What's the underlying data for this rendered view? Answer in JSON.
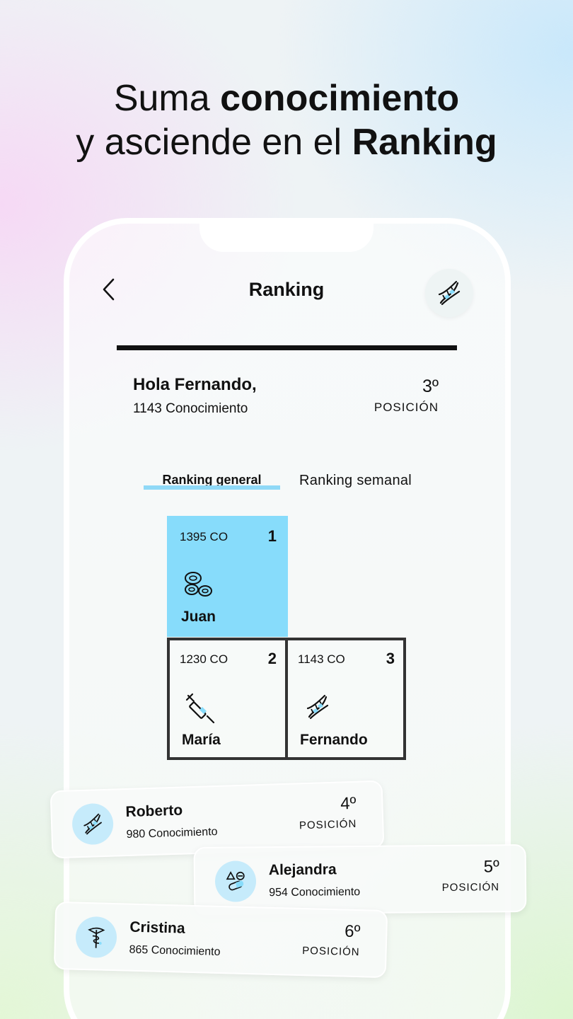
{
  "headline": {
    "line1_normal": "Suma ",
    "line1_bold": "conocimiento",
    "line2_normal": "y asciende en el ",
    "line2_bold": "Ranking"
  },
  "header": {
    "title": "Ranking",
    "back_icon": "chevron-left-icon",
    "avatar_icon": "dna-icon"
  },
  "user": {
    "greeting": "Hola Fernando,",
    "points": "1143 Conocimiento",
    "position": "3º",
    "position_label": "POSICIÓN"
  },
  "tabs": {
    "general": "Ranking general",
    "semanal": "Ranking semanal",
    "active_color": "#8fd9f7"
  },
  "podium": [
    {
      "points": "1395 CO",
      "rank": "1",
      "name": "Juan",
      "icon": "blood-cells-icon"
    },
    {
      "points": "1230 CO",
      "rank": "2",
      "name": "María",
      "icon": "syringe-icon"
    },
    {
      "points": "1143 CO",
      "rank": "3",
      "name": "Fernando",
      "icon": "dna-icon"
    }
  ],
  "leaderboard": [
    {
      "name": "Roberto",
      "points": "980 Conocimiento",
      "position": "4º",
      "position_label": "POSICIÓN",
      "icon": "dna-icon"
    },
    {
      "name": "Alejandra",
      "points": "954 Conocimiento",
      "position": "5º",
      "position_label": "POSICIÓN",
      "icon": "pills-icon"
    },
    {
      "name": "Cristina",
      "points": "865 Conocimiento",
      "position": "6º",
      "position_label": "POSICIÓN",
      "icon": "caduceus-icon"
    }
  ],
  "colors": {
    "accent": "#87dcfb",
    "avatar_bg": "#c6ebfb"
  }
}
